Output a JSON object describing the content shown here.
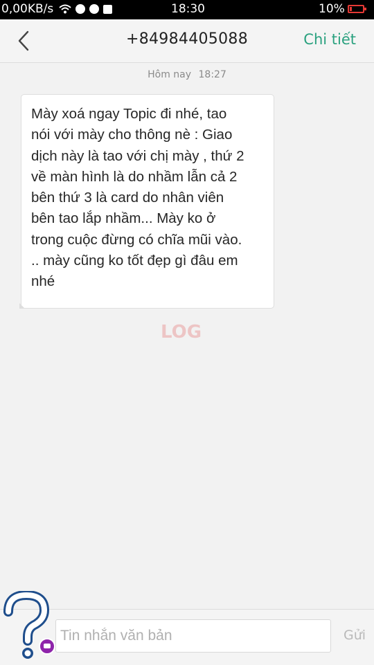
{
  "status_bar": {
    "network_speed": "0,00KB/s",
    "time": "18:30",
    "battery": "10%"
  },
  "header": {
    "title": "+84984405088",
    "detail_label": "Chi tiết"
  },
  "conversation": {
    "date_label": "Hôm nay",
    "date_time": "18:27",
    "message_lines": [
      "Mày xoá ngay Topic đi nhé, tao",
      "nói với mày cho thông nè : Giao",
      "dịch này là tao với chị mày , thứ 2",
      "về màn hình là do nhầm lẫn cả 2",
      "bên thứ 3 là card do nhân viên",
      "bên tao lắp nhầm... Mày ko ở",
      "trong cuộc đừng có chĩa mũi vào.",
      ".. mày cũng ko tốt đẹp gì đâu em",
      "nhé"
    ]
  },
  "watermark_text": "LOG",
  "input_bar": {
    "placeholder": "Tin nhắn văn bản",
    "send_label": "Gửi"
  },
  "colors": {
    "accent": "#2aa17f",
    "battery_low": "#e53935",
    "help_badge": "#8e24aa",
    "help_outline": "#1f4e8c"
  }
}
